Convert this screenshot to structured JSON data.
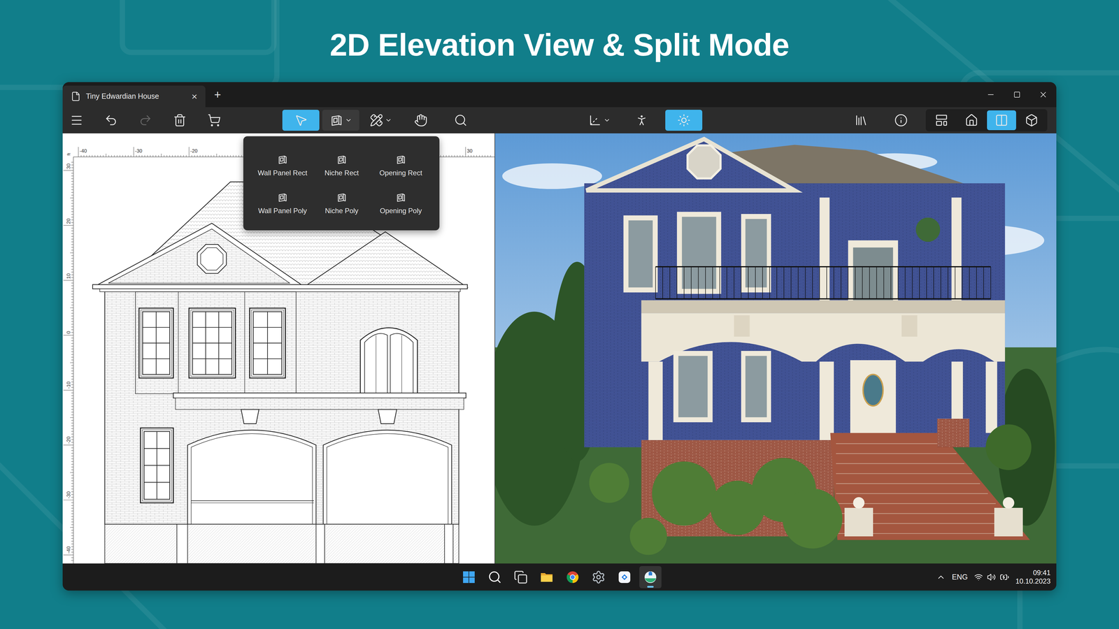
{
  "page": {
    "title": "2D Elevation View & Split Mode"
  },
  "window": {
    "tabs": [
      {
        "label": "Tiny Edwardian House",
        "selected": true
      }
    ],
    "tab_close": "×",
    "new_tab": "+"
  },
  "toolbar": {
    "edit_tools": [
      {
        "disabled": false
      },
      {
        "disabled": false
      },
      {
        "disabled": true
      },
      {
        "disabled": false
      },
      {
        "disabled": false
      }
    ],
    "mode_tools": [
      {
        "selected": true,
        "dropdown": false,
        "expanded": false
      },
      {
        "selected": false,
        "dropdown": true,
        "expanded": true
      },
      {
        "selected": false,
        "dropdown": true,
        "expanded": false
      },
      {
        "selected": false,
        "dropdown": false,
        "expanded": false
      },
      {
        "selected": false,
        "dropdown": false,
        "expanded": false
      }
    ],
    "view_tools": [
      {
        "selected": false,
        "dropdown": true
      },
      {
        "selected": false,
        "dropdown": false
      },
      {
        "selected": true,
        "dropdown": false
      }
    ],
    "panel_tools": [
      {
        "selected": false
      },
      {
        "selected": false
      }
    ],
    "view_modes": [
      {
        "selected": false
      },
      {
        "selected": false
      },
      {
        "selected": true
      },
      {
        "selected": false
      }
    ]
  },
  "wall_panel_menu": {
    "items": [
      {
        "label": "Wall Panel Rect"
      },
      {
        "label": "Niche Rect"
      },
      {
        "label": "Opening Rect"
      },
      {
        "label": "Wall Panel Poly"
      },
      {
        "label": "Niche Poly"
      },
      {
        "label": "Opening Poly"
      }
    ]
  },
  "elevation": {
    "units": "ft",
    "top_ruler": [
      "-40",
      "-30",
      "-20",
      "30"
    ],
    "left_ruler": [
      "30",
      "20",
      "10",
      "0",
      "-10",
      "-20",
      "-30",
      "-40"
    ]
  },
  "taskbar": {
    "apps": [
      {
        "selected": false
      },
      {
        "selected": false
      },
      {
        "selected": false
      },
      {
        "selected": false
      },
      {
        "selected": false
      },
      {
        "selected": false
      },
      {
        "selected": false
      },
      {
        "selected": true
      }
    ],
    "language": "ENG",
    "time": "09:41",
    "date": "10.10.2023"
  }
}
